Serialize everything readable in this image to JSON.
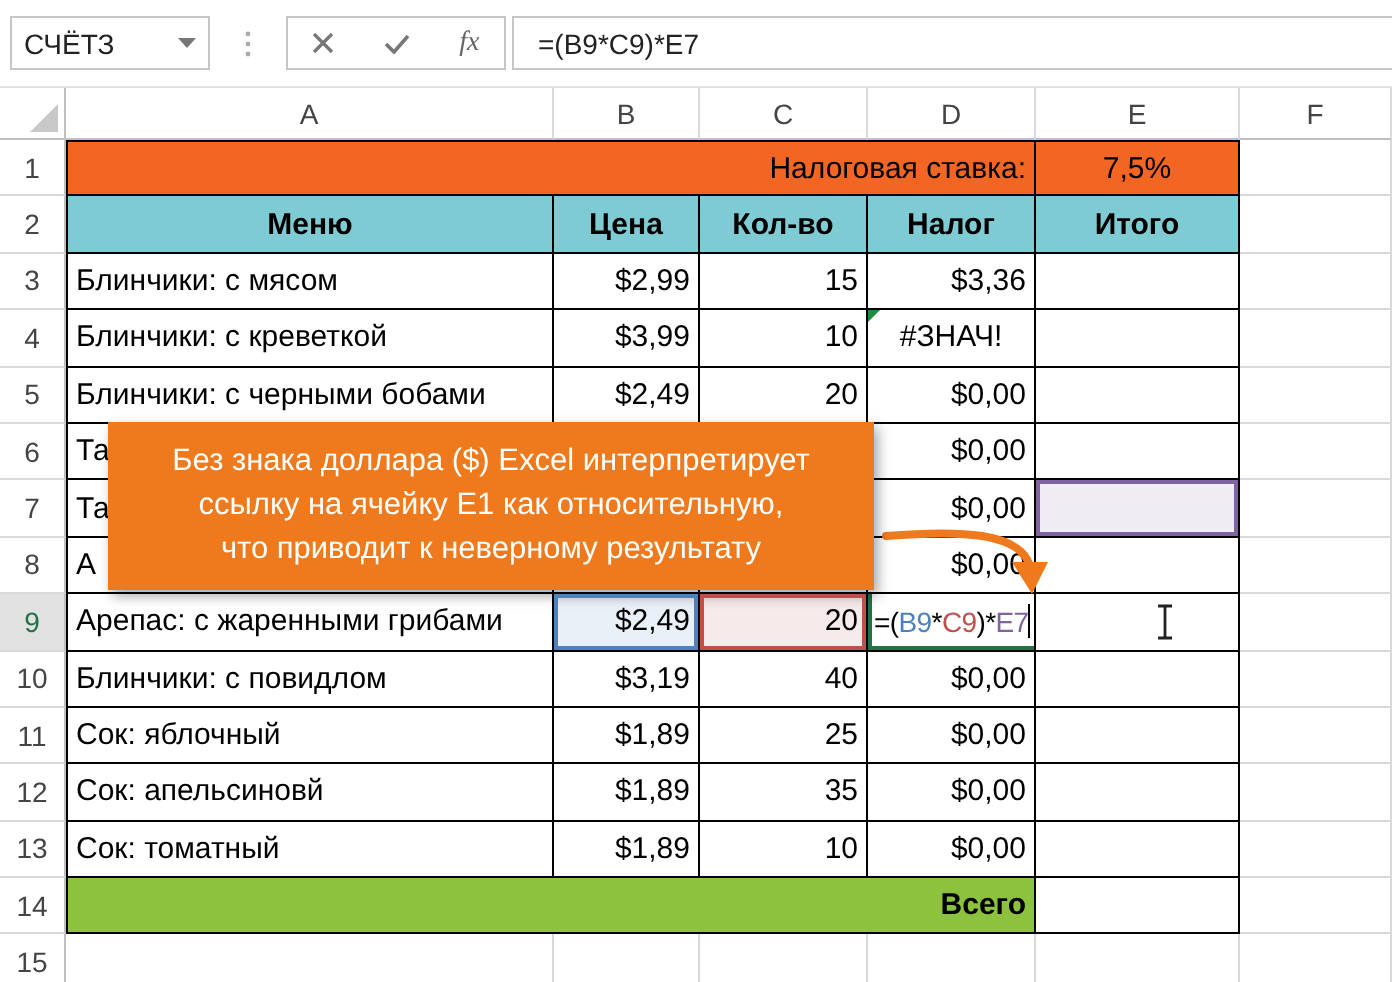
{
  "toolbar": {
    "name_box": "СЧЁТЗ",
    "function_label": "fx",
    "formula": "=(B9*C9)*E7"
  },
  "columns": [
    {
      "label": "A",
      "selected": false
    },
    {
      "label": "B",
      "selected": false
    },
    {
      "label": "C",
      "selected": false
    },
    {
      "label": "D",
      "selected": false
    },
    {
      "label": "E",
      "selected": false
    },
    {
      "label": "F",
      "selected": false
    }
  ],
  "rows": [
    {
      "label": "1",
      "selected": false,
      "kind": "title",
      "title": "Налоговая ставка:",
      "rate": "7,5%"
    },
    {
      "label": "2",
      "selected": false,
      "kind": "header",
      "headers": [
        "Меню",
        "Цена",
        "Кол-во",
        "Налог",
        "Итого"
      ]
    },
    {
      "label": "3",
      "selected": false,
      "kind": "data",
      "cells": [
        {
          "text": "Блинчики: с мясом"
        },
        {
          "text": "$2,99"
        },
        {
          "text": "15"
        },
        {
          "text": "$3,36"
        },
        null
      ]
    },
    {
      "label": "4",
      "selected": false,
      "kind": "data",
      "cells": [
        {
          "text": "Блинчики: с креветкой"
        },
        {
          "text": "$3,99"
        },
        {
          "text": "10"
        },
        {
          "text": "#ЗНАЧ!",
          "error": true
        },
        null
      ]
    },
    {
      "label": "5",
      "selected": false,
      "kind": "data",
      "cells": [
        {
          "text": "Блинчики: с черными бобами"
        },
        {
          "text": "$2,49"
        },
        {
          "text": "20"
        },
        {
          "text": "$0,00"
        },
        null
      ]
    },
    {
      "label": "6",
      "selected": false,
      "kind": "data",
      "cells": [
        {
          "text": "Та"
        },
        null,
        null,
        {
          "text": "$0,00"
        },
        null
      ]
    },
    {
      "label": "7",
      "selected": false,
      "kind": "data",
      "cells": [
        {
          "text": "Та"
        },
        null,
        null,
        {
          "text": "$0,00"
        },
        {
          "color": "#8064a2"
        }
      ]
    },
    {
      "label": "8",
      "selected": false,
      "kind": "data",
      "cells": [
        {
          "text": "А"
        },
        null,
        null,
        {
          "text": "$0,00"
        },
        null
      ]
    },
    {
      "label": "9",
      "selected": true,
      "kind": "data",
      "cells": [
        {
          "text": "Арепас: с жаренными грибами"
        },
        {
          "text": "$2,49",
          "color": "#4f81bd"
        },
        {
          "text": "20",
          "color": "#c0504d"
        },
        {
          "formula": [
            {
              "text": "=("
            },
            {
              "text": "B9",
              "color": "#4f81bd"
            },
            {
              "text": "*"
            },
            {
              "text": "C9",
              "color": "#c0504d"
            },
            {
              "text": ")*"
            },
            {
              "text": "E7",
              "color": "#8064a2"
            }
          ]
        },
        null
      ]
    },
    {
      "label": "10",
      "selected": false,
      "kind": "data",
      "cells": [
        {
          "text": "Блинчики: с повидлом"
        },
        {
          "text": "$3,19"
        },
        {
          "text": "40"
        },
        {
          "text": "$0,00"
        },
        null
      ]
    },
    {
      "label": "11",
      "selected": false,
      "kind": "data",
      "cells": [
        {
          "text": "Сок: яблочный"
        },
        {
          "text": "$1,89"
        },
        {
          "text": "25"
        },
        {
          "text": "$0,00"
        },
        null
      ]
    },
    {
      "label": "12",
      "selected": false,
      "kind": "data",
      "cells": [
        {
          "text": "Сок: апельсиновй"
        },
        {
          "text": "$1,89"
        },
        {
          "text": "35"
        },
        {
          "text": "$0,00"
        },
        null
      ]
    },
    {
      "label": "13",
      "selected": false,
      "kind": "data",
      "cells": [
        {
          "text": "Сок: томатный"
        },
        {
          "text": "$1,89"
        },
        {
          "text": "10"
        },
        {
          "text": "$0,00"
        },
        null
      ]
    },
    {
      "label": "14",
      "selected": false,
      "kind": "total",
      "title": "Всего"
    },
    {
      "label": "15",
      "selected": false,
      "kind": "blank"
    }
  ],
  "callout": {
    "text": "Без знака доллара ($) Excel интерпретирует\nссылку на ячейку E1 как относительную,\nчто приводит к неверному результату"
  }
}
